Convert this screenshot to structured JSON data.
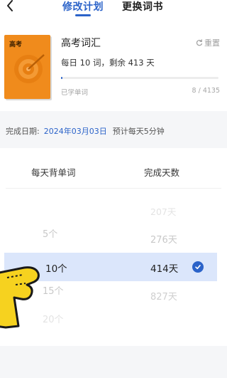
{
  "tabs": {
    "modify_plan": "修改计划",
    "change_book": "更换词书"
  },
  "book": {
    "cover_title": "高考",
    "name": "高考词汇",
    "reset_label": "重置",
    "plan_info": "每日 10 词，剩余 413 天",
    "learned_label": "已学单词",
    "learned_count": "8 / 4135",
    "progress_fraction": 0.0019
  },
  "finish": {
    "label": "完成日期:",
    "date": "2024年03月03日",
    "estimate": "预计每天5分钟"
  },
  "picker": {
    "left_header": "每天背单词",
    "right_header": "完成天数",
    "right_above": "207天",
    "right_above2": "276天",
    "left_above": "5个",
    "selected_left": "10个",
    "selected_right": "414天",
    "left_below": "15个",
    "right_below": "827天",
    "left_below2": "20个"
  },
  "colors": {
    "accent": "#2b63c9",
    "cover": "#f08b1c",
    "selected_band": "#dbe6fb"
  },
  "icons": {
    "back": "chevron-left-icon",
    "reset": "refresh-icon",
    "check": "check-circle-icon",
    "cursor": "hand-pointer-icon"
  }
}
